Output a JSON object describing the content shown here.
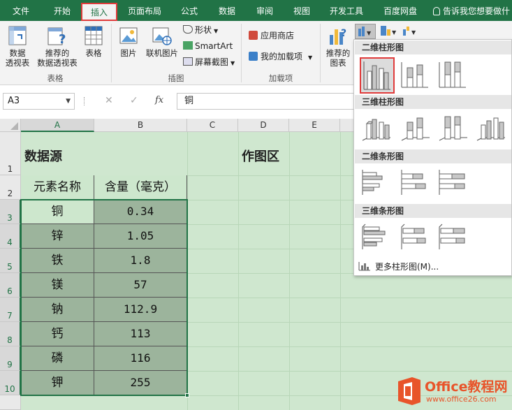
{
  "tabs": [
    {
      "label": "文件",
      "active": false
    },
    {
      "label": "开始",
      "active": false
    },
    {
      "label": "插入",
      "active": true
    },
    {
      "label": "页面布局",
      "active": false
    },
    {
      "label": "公式",
      "active": false
    },
    {
      "label": "数据",
      "active": false
    },
    {
      "label": "审阅",
      "active": false
    },
    {
      "label": "视图",
      "active": false
    },
    {
      "label": "开发工具",
      "active": false
    },
    {
      "label": "百度网盘",
      "active": false
    }
  ],
  "tell_me": "告诉我您想要做什",
  "ribbon": {
    "pivot_table": "数据\n透视表",
    "recommended_pivot": "推荐的\n数据透视表",
    "table": "表格",
    "group_tables": "表格",
    "picture": "图片",
    "online_picture": "联机图片",
    "shapes": "形状",
    "smartart": "SmartArt",
    "screenshot": "屏幕截图",
    "group_illustrations": "插图",
    "app_store": "应用商店",
    "my_addins": "我的加载项",
    "group_addins": "加载项",
    "recommended_charts": "推荐的\n图表"
  },
  "formula_bar": {
    "name_box": "A3",
    "cancel": "✕",
    "confirm": "✓",
    "fx": "fx",
    "value": "铜"
  },
  "columns": [
    "A",
    "B",
    "C",
    "D",
    "E"
  ],
  "rows": [
    "1",
    "2",
    "3",
    "4",
    "5",
    "6",
    "7",
    "8",
    "9",
    "10"
  ],
  "sheet": {
    "title_a1": "数据源",
    "title_d1": "作图区",
    "header": [
      "元素名称",
      "含量（毫克）"
    ],
    "data": [
      [
        "铜",
        "0.34"
      ],
      [
        "锌",
        "1.05"
      ],
      [
        "铁",
        "1.8"
      ],
      [
        "镁",
        "57"
      ],
      [
        "钠",
        "112.9"
      ],
      [
        "钙",
        "113"
      ],
      [
        "磷",
        "116"
      ],
      [
        "钾",
        "255"
      ]
    ]
  },
  "dropdown": {
    "section_2d_column": "二维柱形图",
    "section_3d_column": "三维柱形图",
    "section_2d_bar": "二维条形图",
    "section_3d_bar": "三维条形图",
    "more": "更多柱形图(M)..."
  },
  "watermark": {
    "brand": "Office教程网",
    "url": "www.office26.com"
  },
  "colors": {
    "excel_green": "#217346",
    "highlight_red": "#e03b3b",
    "sheet_bg": "#cfe7cf",
    "data_fill": "#9cb49c"
  }
}
